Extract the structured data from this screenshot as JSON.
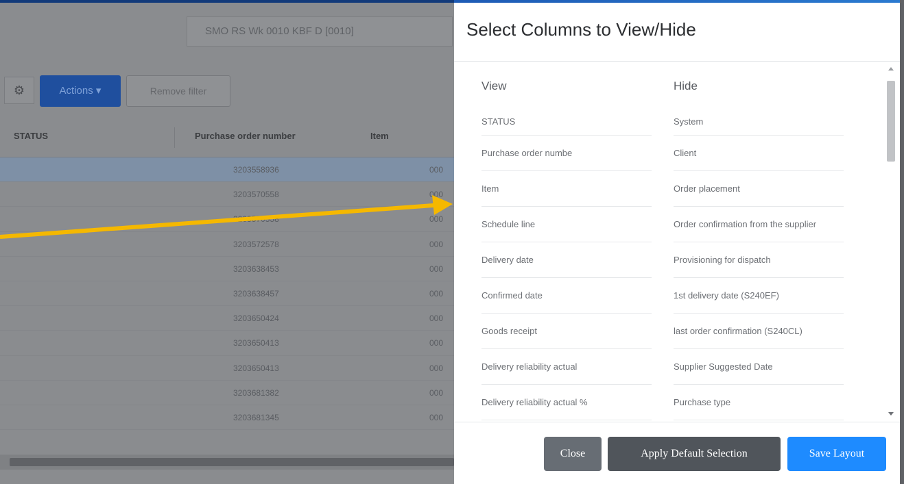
{
  "app": {
    "title_field": "SMO RS Wk 0010 KBF D [0010]",
    "toolbar": {
      "settings_icon": "gear-icon",
      "actions_label": "Actions ▾",
      "remove_filter_label": "Remove filter"
    },
    "table": {
      "headers": [
        "STATUS",
        "Purchase order number",
        "Item"
      ],
      "rows": [
        {
          "po": "3203558936",
          "item": "000"
        },
        {
          "po": "3203570558",
          "item": "000"
        },
        {
          "po": "3203570558",
          "item": "000"
        },
        {
          "po": "3203572578",
          "item": "000"
        },
        {
          "po": "3203638453",
          "item": "000"
        },
        {
          "po": "3203638457",
          "item": "000"
        },
        {
          "po": "3203650424",
          "item": "000"
        },
        {
          "po": "3203650413",
          "item": "000"
        },
        {
          "po": "3203650413",
          "item": "000"
        },
        {
          "po": "3203681382",
          "item": "000"
        },
        {
          "po": "3203681345",
          "item": "000"
        }
      ]
    }
  },
  "modal": {
    "title": "Select Columns to View/Hide",
    "view_heading": "View",
    "hide_heading": "Hide",
    "view_items": [
      "STATUS",
      "Purchase order numbe",
      "Item",
      "Schedule line",
      "Delivery date",
      "Confirmed date",
      "Goods receipt",
      "Delivery reliability actual",
      "Delivery reliability actual %"
    ],
    "hide_items": [
      "System",
      "Client",
      "Order placement",
      "Order confirmation from the supplier",
      "Provisioning for dispatch",
      "1st delivery date (S240EF)",
      "last order confirmation (S240CL)",
      "Supplier Suggested Date",
      "Purchase type"
    ],
    "buttons": {
      "close": "Close",
      "apply_default": "Apply Default Selection",
      "save_layout": "Save Layout"
    }
  },
  "colors": {
    "arrow": "#f5b800",
    "save_button": "#1e8bff",
    "overlay": "#8a8c8f"
  }
}
